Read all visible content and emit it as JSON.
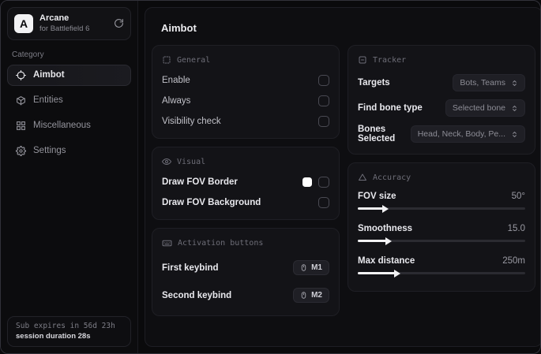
{
  "app": {
    "logo_letter": "A",
    "title": "Arcane",
    "subtitle": "for Battlefield 6"
  },
  "sidebar": {
    "category_label": "Category",
    "items": [
      {
        "label": "Aimbot",
        "icon": "crosshair-icon",
        "active": true
      },
      {
        "label": "Entities",
        "icon": "entities-icon",
        "active": false
      },
      {
        "label": "Miscellaneous",
        "icon": "grid-icon",
        "active": false
      },
      {
        "label": "Settings",
        "icon": "gear-icon",
        "active": false
      }
    ],
    "footer": {
      "sub_expires": "Sub expires in 56d 23h",
      "session_duration": "session duration 28s"
    }
  },
  "main": {
    "title": "Aimbot",
    "cards": {
      "general": {
        "title": "General",
        "icon": "scan-icon",
        "rows": [
          {
            "label": "Enable",
            "control": "checkbox",
            "checked": false
          },
          {
            "label": "Always",
            "control": "checkbox",
            "checked": false
          },
          {
            "label": "Visibility check",
            "control": "checkbox",
            "checked": false
          }
        ]
      },
      "visual": {
        "title": "Visual",
        "icon": "eye-icon",
        "rows": [
          {
            "label": "Draw FOV Border",
            "control": "color-checkbox",
            "color": "#ffffff",
            "checked": false
          },
          {
            "label": "Draw FOV Background",
            "control": "checkbox",
            "checked": false
          }
        ]
      },
      "activation": {
        "title": "Activation buttons",
        "icon": "keyboard-icon",
        "rows": [
          {
            "label": "First keybind",
            "key": "M1"
          },
          {
            "label": "Second keybind",
            "key": "M2"
          }
        ]
      },
      "tracker": {
        "title": "Tracker",
        "icon": "frame-minus-icon",
        "rows": [
          {
            "label": "Targets",
            "value": "Bots, Teams"
          },
          {
            "label": "Find bone type",
            "value": "Selected bone"
          },
          {
            "label": "Bones Selected",
            "value": "Head, Neck, Body, Pe..."
          }
        ]
      },
      "accuracy": {
        "title": "Accuracy",
        "icon": "triangle-icon",
        "rows": [
          {
            "label": "FOV size",
            "value": "50°",
            "percent": 15
          },
          {
            "label": "Smoothness",
            "value": "15.0",
            "percent": 17
          },
          {
            "label": "Max distance",
            "value": "250m",
            "percent": 22
          }
        ]
      }
    }
  },
  "colors": {
    "accent_fill": "#f2f2f4",
    "fov_border_swatch": "#ffffff",
    "card_bg": "#131317",
    "page_bg": "#09090b"
  }
}
